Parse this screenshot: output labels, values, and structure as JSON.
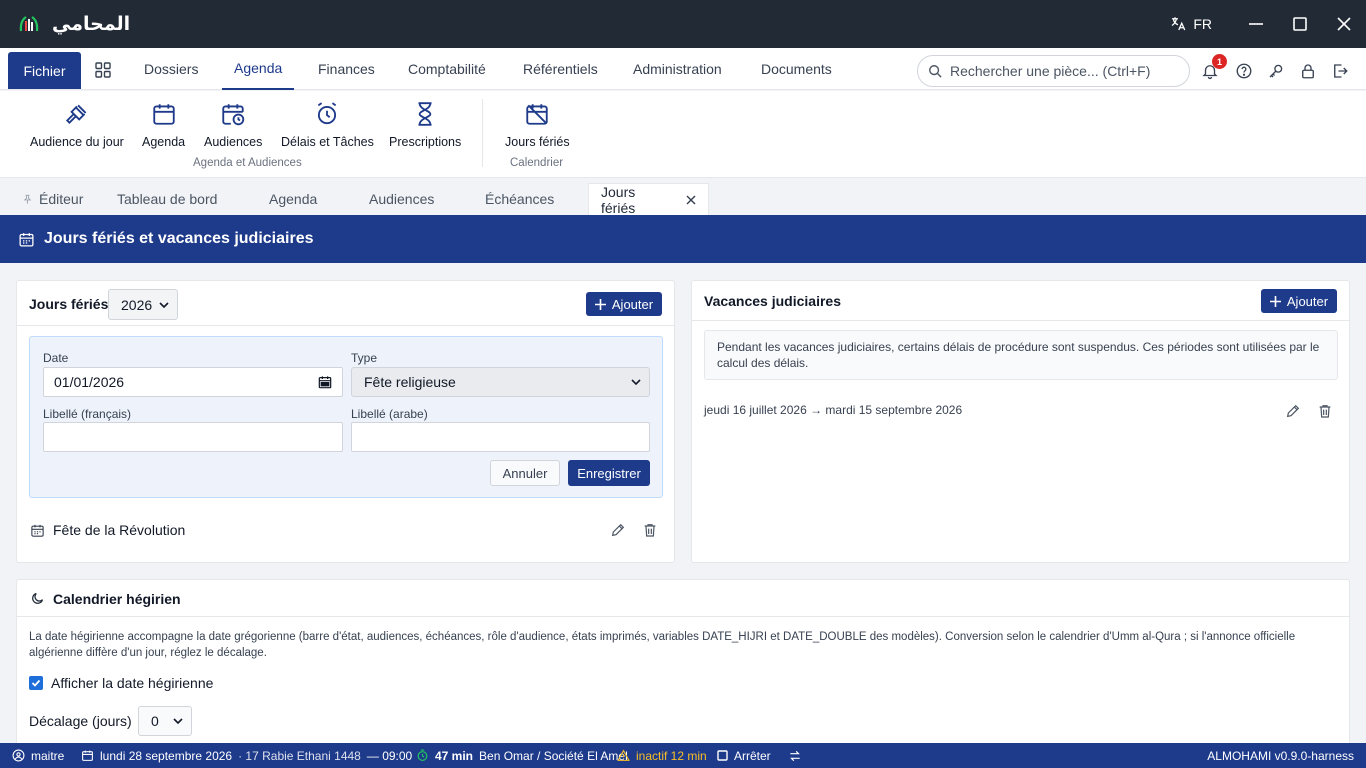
{
  "app": {
    "logo_text": "المحامي",
    "language": "FR"
  },
  "menu": {
    "fichier": "Fichier",
    "items": [
      "Dossiers",
      "Agenda",
      "Finances",
      "Comptabilité",
      "Référentiels",
      "Administration",
      "Documents"
    ],
    "search_placeholder": "Rechercher une pièce... (Ctrl+F)",
    "notifications_count": "1"
  },
  "ribbon": {
    "buttons": [
      "Audience du jour",
      "Agenda",
      "Audiences",
      "Délais et Tâches",
      "Prescriptions",
      "Jours fériés"
    ],
    "groups": [
      "Agenda et Audiences",
      "Calendrier"
    ]
  },
  "tabs": {
    "editor": "Éditeur",
    "items": [
      "Tableau de bord",
      "Agenda",
      "Audiences",
      "Échéances"
    ],
    "active": "Jours fériés"
  },
  "page": {
    "title": "Jours fériés et vacances judiciaires"
  },
  "holidays": {
    "title": "Jours fériés",
    "year": "2026",
    "add_label": "Ajouter",
    "form": {
      "date_label": "Date",
      "date_value": "01/01/2026",
      "type_label": "Type",
      "type_value": "Fête religieuse",
      "libelle_fr_label": "Libellé (français)",
      "libelle_ar_label": "Libellé (arabe)",
      "cancel_label": "Annuler",
      "save_label": "Enregistrer"
    },
    "list": [
      {
        "name": "Fête de la Révolution"
      }
    ]
  },
  "vacances": {
    "title": "Vacances judiciaires",
    "add_label": "Ajouter",
    "info": "Pendant les vacances judiciaires, certains délais de procédure sont suspendus. Ces périodes sont utilisées par le calcul des délais.",
    "periods": [
      {
        "range": "jeudi 16 juillet 2026 → mardi 15 septembre 2026"
      }
    ]
  },
  "hijri": {
    "title": "Calendrier hégirien",
    "description": "La date hégirienne accompagne la date grégorienne (barre d'état, audiences, échéances, rôle d'audience, états imprimés, variables DATE_HIJRI et DATE_DOUBLE des modèles). Conversion selon le calendrier d'Umm al-Qura ; si l'annonce officielle algérienne diffère d'un jour, réglez le décalage.",
    "show_label": "Afficher la date hégirienne",
    "show_checked": true,
    "offset_label": "Décalage (jours)",
    "offset_value": "0"
  },
  "status": {
    "user": "maitre",
    "date": "lundi 28 septembre 2026",
    "hijri": "· 17 Rabie Ethani 1448",
    "time": "— 09:00",
    "timer": "47 min",
    "client": "Ben Omar / Société El Amel",
    "inactive": "inactif 12 min",
    "stop": "Arrêter",
    "version": "ALMOHAMI v0.9.0-harness"
  },
  "colors": {
    "primary": "#1e3a8a",
    "titlebar": "#222a36",
    "warning": "#f59e0b",
    "success": "#16a34a"
  }
}
